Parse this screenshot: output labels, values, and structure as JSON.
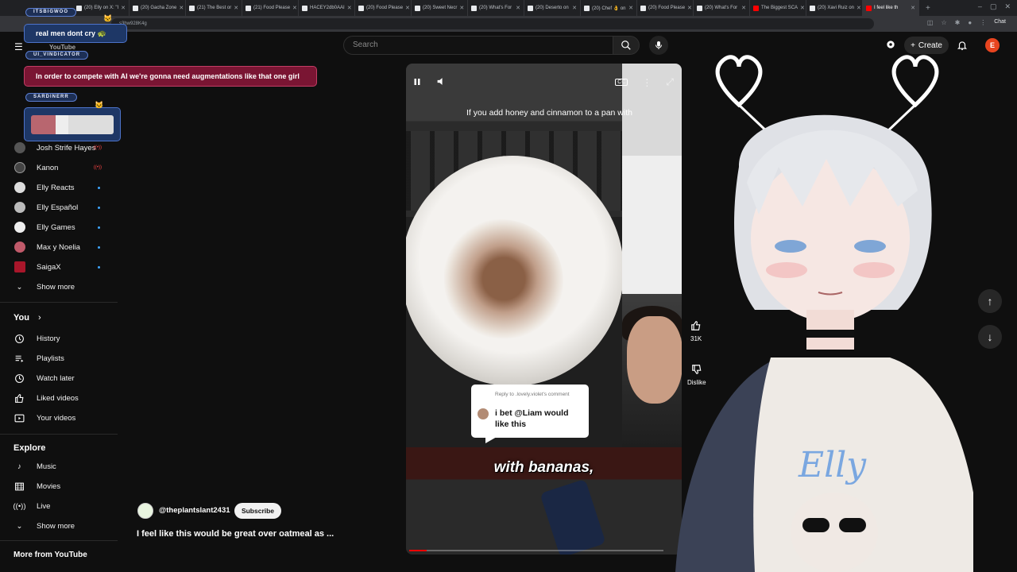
{
  "browser": {
    "tabs": [
      {
        "label": "(20) Elly on X: \"I"
      },
      {
        "label": "(20) Gacha Zone"
      },
      {
        "label": "(21) The Best or"
      },
      {
        "label": "(21) Food Please"
      },
      {
        "label": "HACEY2db0AAI"
      },
      {
        "label": "(20) Food Please"
      },
      {
        "label": "(20) Sweet Necr"
      },
      {
        "label": "(20) What's For"
      },
      {
        "label": "(20) Deserto on"
      },
      {
        "label": "(20) Chef 👌 on"
      },
      {
        "label": "(20) Food Please"
      },
      {
        "label": "(20) What's For"
      },
      {
        "label": "The Biggest SCA"
      },
      {
        "label": "(20) Xavi Ruiz on"
      },
      {
        "label": "I feel like th"
      }
    ],
    "url": "s3hw928K4g",
    "chat_label": "Chat"
  },
  "header": {
    "logo_text": "YouTube",
    "search_placeholder": "Search",
    "create_label": "Create",
    "account_initial": "E"
  },
  "chat": [
    {
      "name": "ITSBIGWOO",
      "message": "real men dont cry 🐢"
    },
    {
      "name": "UI_VINDICATOR",
      "message": "In order to compete with AI we're gonna need augmentations like that one girl"
    },
    {
      "name": "SARDINERR",
      "message": ""
    }
  ],
  "sidebar": {
    "subscriptions": [
      {
        "label": "Josh Strife Hayes",
        "badge": "live"
      },
      {
        "label": "Kanon",
        "badge": "live"
      },
      {
        "label": "Elly Reacts",
        "badge": "dot"
      },
      {
        "label": "Elly Español",
        "badge": "dot"
      },
      {
        "label": "Elly Games",
        "badge": "dot"
      },
      {
        "label": "Max y Noelia",
        "badge": "dot"
      },
      {
        "label": "SaigaX",
        "badge": "dot"
      }
    ],
    "show_more_1": "Show more",
    "you_heading": "You",
    "you_items": [
      {
        "label": "History",
        "icon": "history-icon"
      },
      {
        "label": "Playlists",
        "icon": "playlists-icon"
      },
      {
        "label": "Watch later",
        "icon": "clock-icon"
      },
      {
        "label": "Liked videos",
        "icon": "thumbs-up-icon"
      },
      {
        "label": "Your videos",
        "icon": "video-icon"
      }
    ],
    "explore_heading": "Explore",
    "explore_items": [
      {
        "label": "Music",
        "icon": "music-icon"
      },
      {
        "label": "Movies",
        "icon": "film-icon"
      },
      {
        "label": "Live",
        "icon": "live-icon"
      }
    ],
    "show_more_2": "Show more",
    "more_heading": "More from YouTube"
  },
  "short": {
    "caption_top": "If you add honey and cinnamon to a pan with",
    "reply_to": "Reply to .lovely.violet's comment",
    "reply_text": "i bet @Liam would like this",
    "caption_bottom": "with bananas,",
    "progress": 0.07,
    "likes": "31K",
    "dislike_label": "Dislike",
    "cc_label": "CC"
  },
  "channel": {
    "handle": "@theplantslant2431",
    "subscribe_label": "Subscribe",
    "title": "I feel like this would be great over oatmeal as ..."
  },
  "colors": {
    "accent_red": "#ff0000",
    "chat_blue": "#1e3766",
    "chat_pink": "#7a1533",
    "account_orange": "#e8441f"
  }
}
